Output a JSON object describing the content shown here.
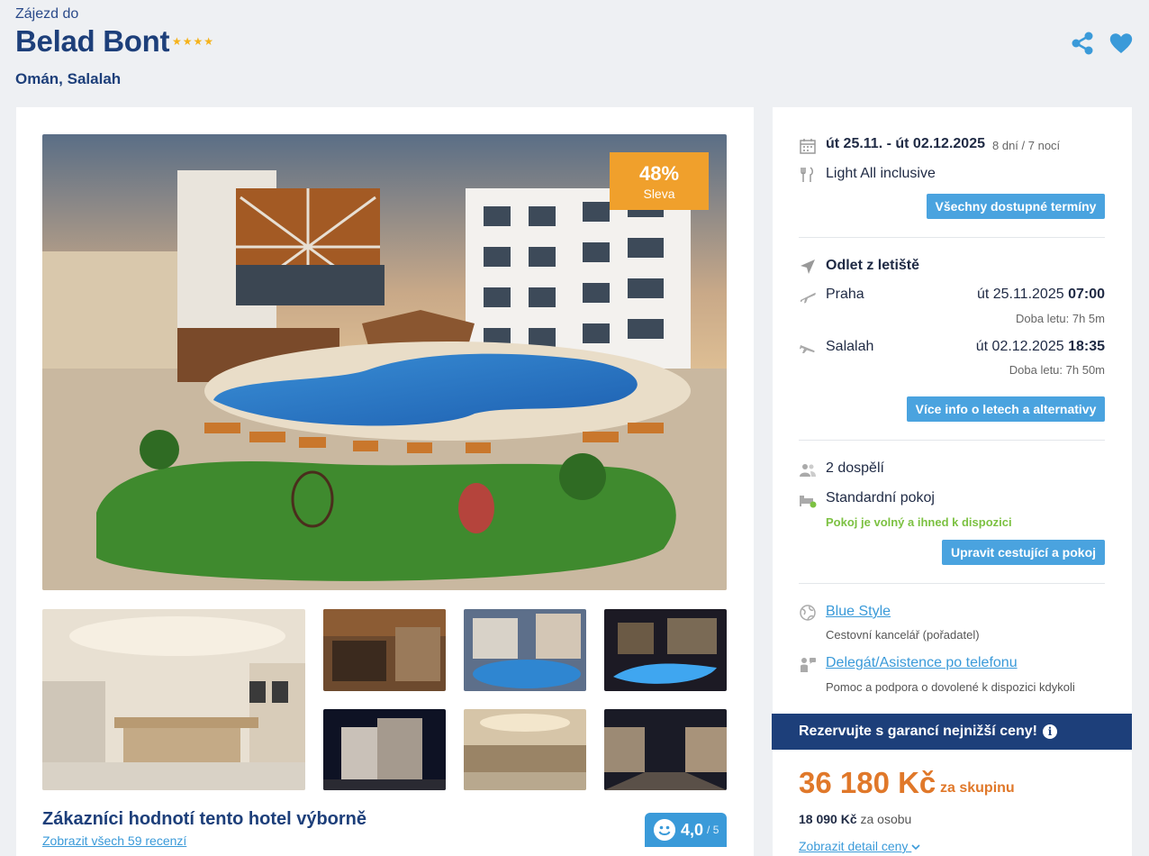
{
  "header": {
    "subtitle": "Zájezd do",
    "hotel_name": "Belad Bont",
    "star_count": 4,
    "location": "Omán, Salalah"
  },
  "gallery": {
    "discount_percent": "48%",
    "discount_label": "Sleva",
    "thumbnails": [
      "restaurant-interior",
      "pergola-terrace",
      "pool-dusk",
      "pool-night",
      "hotel-facade-night",
      "dining-hall",
      "street-night"
    ]
  },
  "reviews": {
    "title": "Zákazníci hodnotí tento hotel výborně",
    "link": "Zobrazit všech 59 recenzí",
    "score": "4,0",
    "score_max": "/ 5"
  },
  "trip": {
    "dates": "út 25.11. - út 02.12.2025",
    "duration": "8 dní / 7 nocí",
    "board": "Light All inclusive",
    "dates_button": "Všechny dostupné termíny"
  },
  "flights": {
    "heading": "Odlet z letiště",
    "outbound_city": "Praha",
    "outbound_date": "út 25.11.2025",
    "outbound_time": "07:00",
    "outbound_duration": "Doba letu: 7h 5m",
    "return_city": "Salalah",
    "return_date": "út 02.12.2025",
    "return_time": "18:35",
    "return_duration": "Doba letu: 7h 50m",
    "button": "Více info o letech a alternativy"
  },
  "room": {
    "travelers": "2 dospělí",
    "room_type": "Standardní pokoj",
    "availability": "Pokoj je volný a ihned k dispozici",
    "button": "Upravit cestující a pokoj"
  },
  "agency": {
    "name": "Blue Style",
    "description": "Cestovní kancelář (pořadatel)",
    "assist_link": "Delegát/Asistence po telefonu",
    "assist_description": "Pomoc a podpora o dovolené k dispozici kdykoli"
  },
  "booking": {
    "banner": "Rezervujte s garancí nejnižší ceny!",
    "price": "36 180 Kč",
    "price_unit": "za skupinu",
    "per_person_price": "18 090 Kč",
    "per_person_label": "za osobu",
    "detail_link": "Zobrazit detail ceny"
  },
  "colors": {
    "brand_blue": "#1d3f7a",
    "accent_blue": "#4aa3df",
    "discount_orange": "#f0a02c",
    "price_orange": "#e0782a",
    "available_green": "#7cc142"
  }
}
